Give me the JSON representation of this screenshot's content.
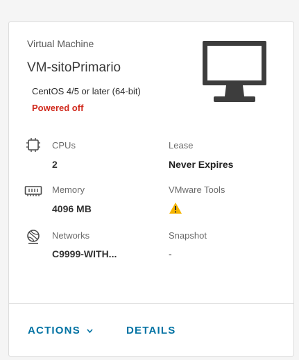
{
  "card": {
    "type_label": "Virtual Machine",
    "name": "VM-sitoPrimario",
    "guest_os": "CentOS 4/5 or later (64-bit)",
    "power_state": "Powered off",
    "power_state_color": "#d0291c",
    "main_icon": "monitor-icon"
  },
  "properties": {
    "cpus": {
      "label": "CPUs",
      "value": "2",
      "icon": "cpu-chip-icon"
    },
    "memory": {
      "label": "Memory",
      "value": "4096 MB",
      "icon": "memory-module-icon"
    },
    "networks": {
      "label": "Networks",
      "value": "C9999-WITH...",
      "icon": "network-globe-icon"
    },
    "lease": {
      "label": "Lease",
      "value": "Never Expires"
    },
    "vmware_tools": {
      "label": "VMware Tools",
      "icon": "warning-icon",
      "icon_color": "#f5b400"
    },
    "snapshot": {
      "label": "Snapshot",
      "value": "-"
    }
  },
  "actions": {
    "actions_label": "ACTIONS",
    "details_label": "DETAILS",
    "link_color": "#0072a3"
  }
}
